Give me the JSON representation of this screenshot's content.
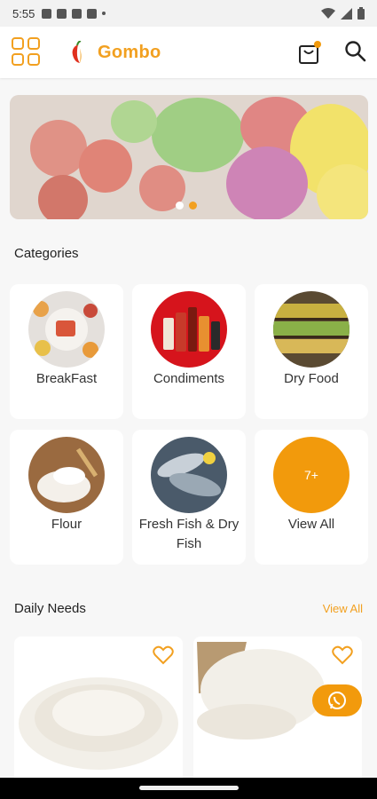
{
  "status_bar": {
    "time": "5:55"
  },
  "header": {
    "brand": "Gombo"
  },
  "sections": {
    "categories_title": "Categories",
    "daily_needs_title": "Daily Needs",
    "view_all_link": "View All"
  },
  "categories": [
    {
      "label": "BreakFast"
    },
    {
      "label": "Condiments"
    },
    {
      "label": "Dry Food"
    },
    {
      "label": "Flour"
    },
    {
      "label": "Fresh Fish & Dry Fish"
    },
    {
      "label": "View All",
      "badge": "7+"
    }
  ],
  "colors": {
    "accent": "#f2a020",
    "background": "#f7f7f7"
  }
}
